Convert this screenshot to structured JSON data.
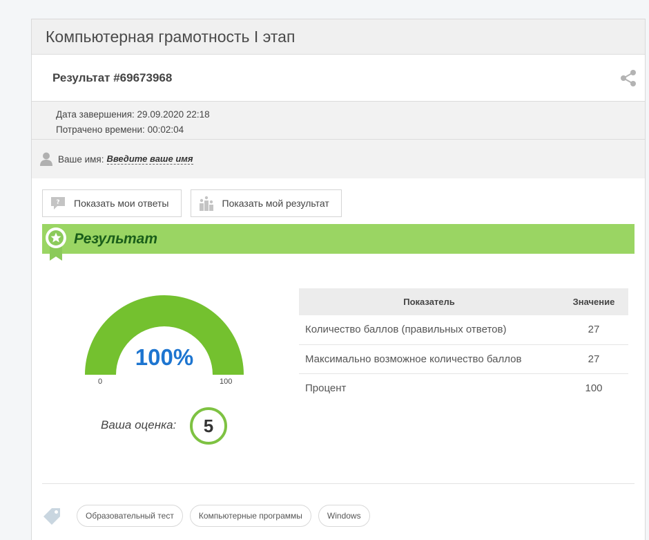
{
  "test": {
    "title": "Компьютерная грамотность I этап"
  },
  "result": {
    "title": "Результат #69673968"
  },
  "meta": {
    "finished_label": "Дата завершения:",
    "finished_value": "29.09.2020 22:18",
    "spent_label": "Потрачено времени:",
    "spent_value": "00:02:04"
  },
  "user": {
    "name_label": "Ваше имя:",
    "name_placeholder": "Введите ваше имя"
  },
  "buttons": {
    "show_answers": "Показать мои ответы",
    "show_result": "Показать мой результат"
  },
  "banner": {
    "title": "Результат",
    "color": "#9ad563"
  },
  "gauge": {
    "percent": 100,
    "percent_label": "100%",
    "min_label": "0",
    "max_label": "100",
    "fill_color": "#74c12f",
    "text_color": "#1d75d0"
  },
  "grade": {
    "label": "Ваша оценка:",
    "value": "5"
  },
  "stats": {
    "headers": [
      "Показатель",
      "Значение"
    ],
    "rows": [
      {
        "label": "Количество баллов (правильных ответов)",
        "value": "27"
      },
      {
        "label": "Максимально возможное количество баллов",
        "value": "27"
      },
      {
        "label": "Процент",
        "value": "100"
      }
    ]
  },
  "tags": [
    "Образовательный тест",
    "Компьютерные программы",
    "Windows"
  ],
  "icons": {
    "share": "share-icon",
    "user": "user-icon",
    "answers": "question-bubble-icon",
    "result": "podium-icon",
    "medal": "medal-icon",
    "tag": "tag-icon"
  }
}
